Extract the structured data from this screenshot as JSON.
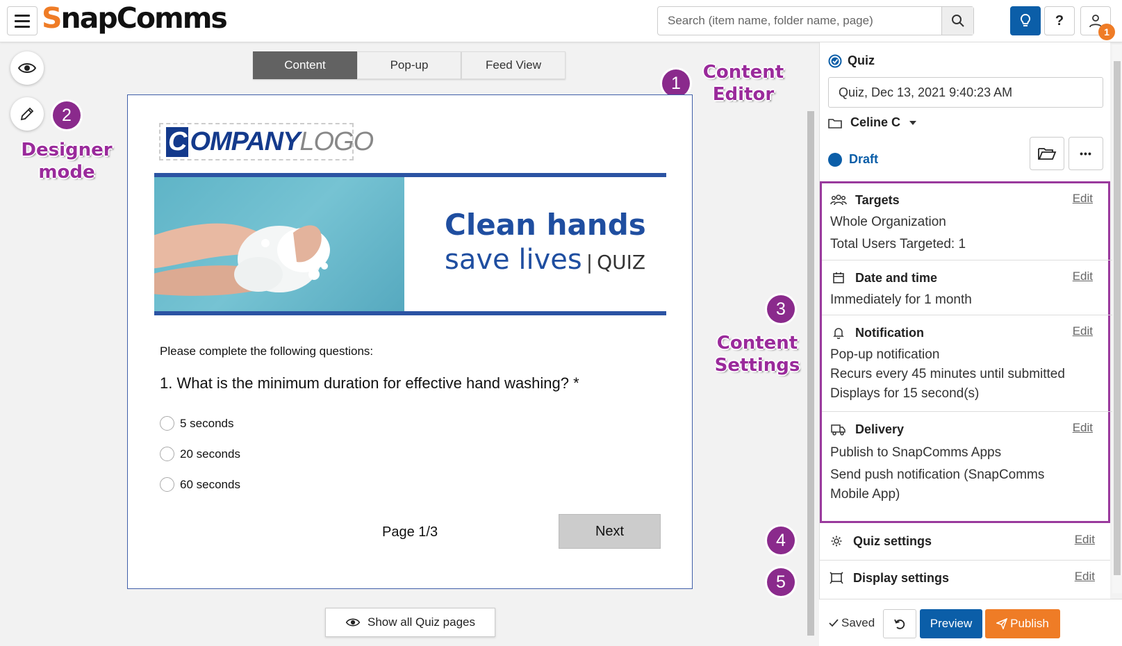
{
  "header": {
    "logo_text": "SnapComms",
    "search_placeholder": "Search (item name, folder name, page)",
    "help_label": "?",
    "notification_count": "1"
  },
  "annotations": {
    "m1": "1",
    "m2": "2",
    "m3": "3",
    "m4": "4",
    "m5": "5",
    "content_editor_1": "Content",
    "content_editor_2": "Editor",
    "designer_mode_1": "Designer",
    "designer_mode_2": "mode",
    "content_settings_1": "Content",
    "content_settings_2": "Settings"
  },
  "tabs": [
    {
      "label": "Content",
      "active": true
    },
    {
      "label": "Pop-up",
      "active": false
    },
    {
      "label": "Feed View",
      "active": false
    }
  ],
  "card": {
    "logo_c": "C",
    "logo_company": "OMPANY",
    "logo_logo": "LOGO",
    "banner_title": "Clean hands",
    "banner_sub": "save lives",
    "banner_pipe": "|",
    "banner_quiz": "QUIZ",
    "instructions": "Please complete the following questions:",
    "question": "1. What is the minimum duration for effective hand washing? *",
    "options": [
      "5 seconds",
      "20 seconds",
      "60 seconds"
    ],
    "page_indicator": "Page 1/3",
    "next_label": "Next"
  },
  "show_all_label": "Show all Quiz pages",
  "panel": {
    "type_label": "Quiz",
    "item_name": "Quiz, Dec 13, 2021 9:40:23 AM",
    "folder_owner": "Celine C",
    "status": "Draft",
    "more_label": "•••",
    "edit_label": "Edit",
    "sections": {
      "targets": {
        "title": "Targets",
        "lines": [
          "Whole Organization",
          "Total Users Targeted: 1"
        ]
      },
      "datetime": {
        "title": "Date and time",
        "lines": [
          "Immediately for 1 month"
        ]
      },
      "notification": {
        "title": "Notification",
        "lines": [
          "Pop-up notification",
          "Recurs every 45 minutes until submitted",
          "Displays for 15 second(s)"
        ]
      },
      "delivery": {
        "title": "Delivery",
        "lines": [
          "Publish to SnapComms Apps",
          "Send push notification (SnapComms",
          "Mobile App)"
        ]
      },
      "quiz_settings": {
        "title": "Quiz settings"
      },
      "display_settings": {
        "title": "Display settings"
      }
    }
  },
  "bottom": {
    "saved_label": "Saved",
    "preview_label": "Preview",
    "publish_label": "Publish"
  },
  "colors": {
    "brand_orange": "#ef7c26",
    "brand_blue": "#0b5ea8",
    "annotation_purple": "#9a2a9b"
  }
}
